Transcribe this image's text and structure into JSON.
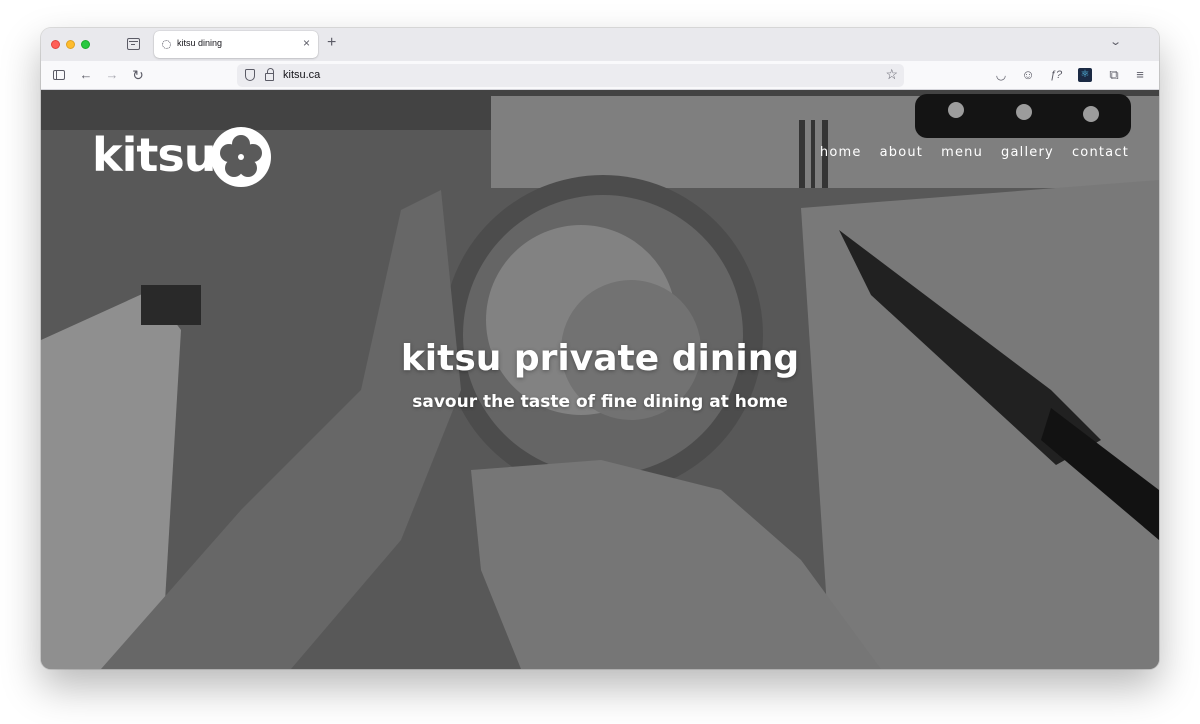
{
  "browser": {
    "tab_title": "kitsu dining",
    "tab_close": "×",
    "new_tab": "+",
    "tab_list": "⌄",
    "url": "kitsu.ca",
    "nav": {
      "back": "←",
      "forward": "→",
      "reload": "↻",
      "bookmark": "☆"
    },
    "toolbar": {
      "pocket": "◡",
      "account": "☺",
      "formula": "ƒ?",
      "extensions": "⧉",
      "menu": "≡"
    }
  },
  "site": {
    "logo_text": "kitsu",
    "nav": [
      "home",
      "about",
      "menu",
      "gallery",
      "contact"
    ],
    "hero_title": "kitsu private dining",
    "hero_subtitle": "savour the taste of fine dining at home"
  },
  "colors": {
    "overlay": "#000000",
    "text": "#ffffff",
    "traffic_red": "#ff5f57",
    "traffic_yellow": "#febc2e",
    "traffic_green": "#28c840"
  }
}
